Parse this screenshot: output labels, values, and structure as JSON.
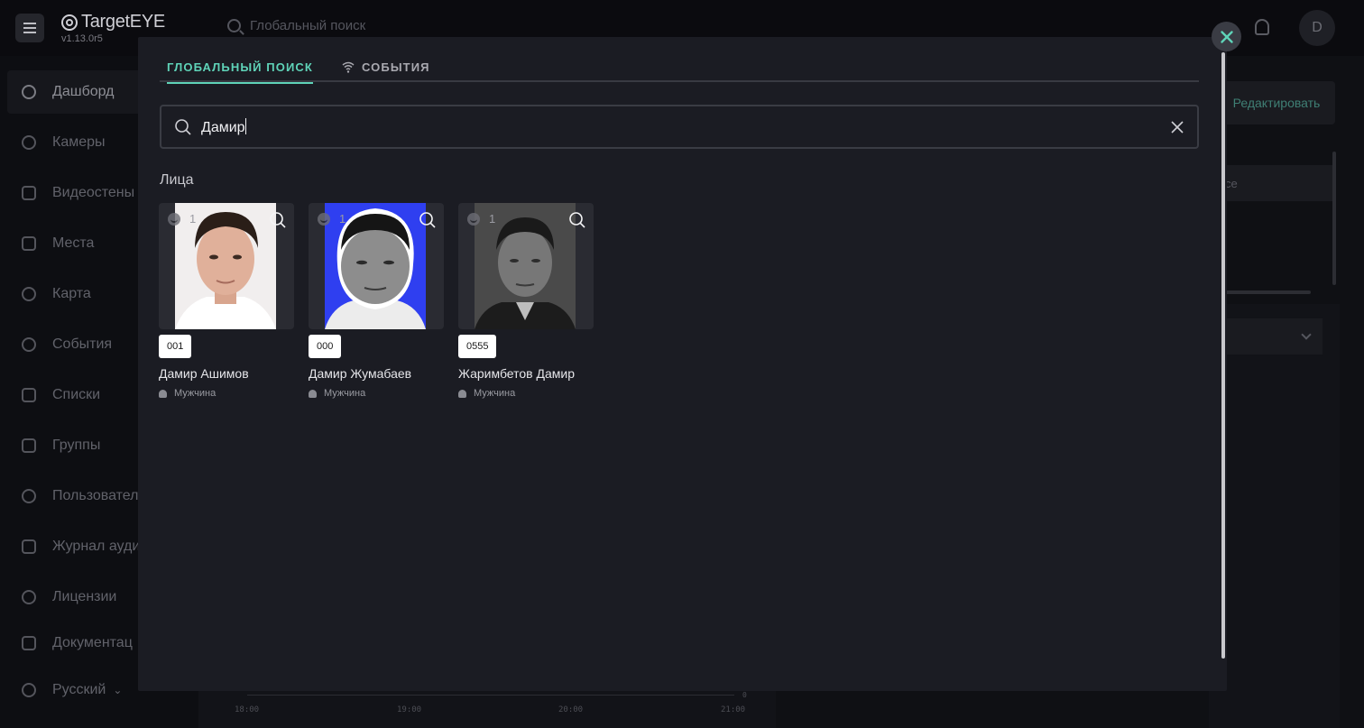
{
  "app": {
    "logo": "TargetEYE",
    "version": "v1.13.0r5",
    "top_search_placeholder": "Глобальный поиск",
    "avatar_initial": "D"
  },
  "sidebar": {
    "items": [
      {
        "label": "Дашборд",
        "icon": "dashboard-icon",
        "active": true
      },
      {
        "label": "Камеры",
        "icon": "camera-icon"
      },
      {
        "label": "Видеостены",
        "icon": "videowall-icon"
      },
      {
        "label": "Места",
        "icon": "places-icon"
      },
      {
        "label": "Карта",
        "icon": "map-pin-icon"
      },
      {
        "label": "События",
        "icon": "events-icon"
      },
      {
        "label": "Списки",
        "icon": "folder-icon"
      },
      {
        "label": "Группы",
        "icon": "groups-icon"
      },
      {
        "label": "Пользовател",
        "icon": "users-icon"
      },
      {
        "label": "Журнал ауди",
        "icon": "audit-log-icon"
      },
      {
        "label": "Лицензии",
        "icon": "license-icon"
      },
      {
        "label": "Документац",
        "icon": "docs-icon"
      },
      {
        "label": "Русский",
        "icon": "globe-icon"
      }
    ]
  },
  "background": {
    "edit_button": "Редактировать",
    "field_text": "се",
    "chart_ticks": [
      "18:00",
      "19:00",
      "20:00",
      "21:00"
    ],
    "chart_zero": "0"
  },
  "modal": {
    "tabs": [
      {
        "label": "ГЛОБАЛЬНЫЙ ПОИСК",
        "active": true
      },
      {
        "label": "СОБЫТИЯ",
        "active": false,
        "icon": "wifi-icon"
      }
    ],
    "search": {
      "value": "Дамир"
    },
    "section_title": "Лица",
    "results": [
      {
        "count": "1",
        "tag": "001",
        "name": "Дамир Ашимов",
        "gender": "Мужчина"
      },
      {
        "count": "1",
        "tag": "000",
        "name": "Дамир Жумабаев",
        "gender": "Мужчина"
      },
      {
        "count": "1",
        "tag": "0555",
        "name": "Жаримбетов Дамир",
        "gender": "Мужчина"
      }
    ]
  },
  "colors": {
    "accent": "#5fd3b8",
    "modal_bg": "#1b1c23",
    "page_bg": "#0f1014"
  }
}
